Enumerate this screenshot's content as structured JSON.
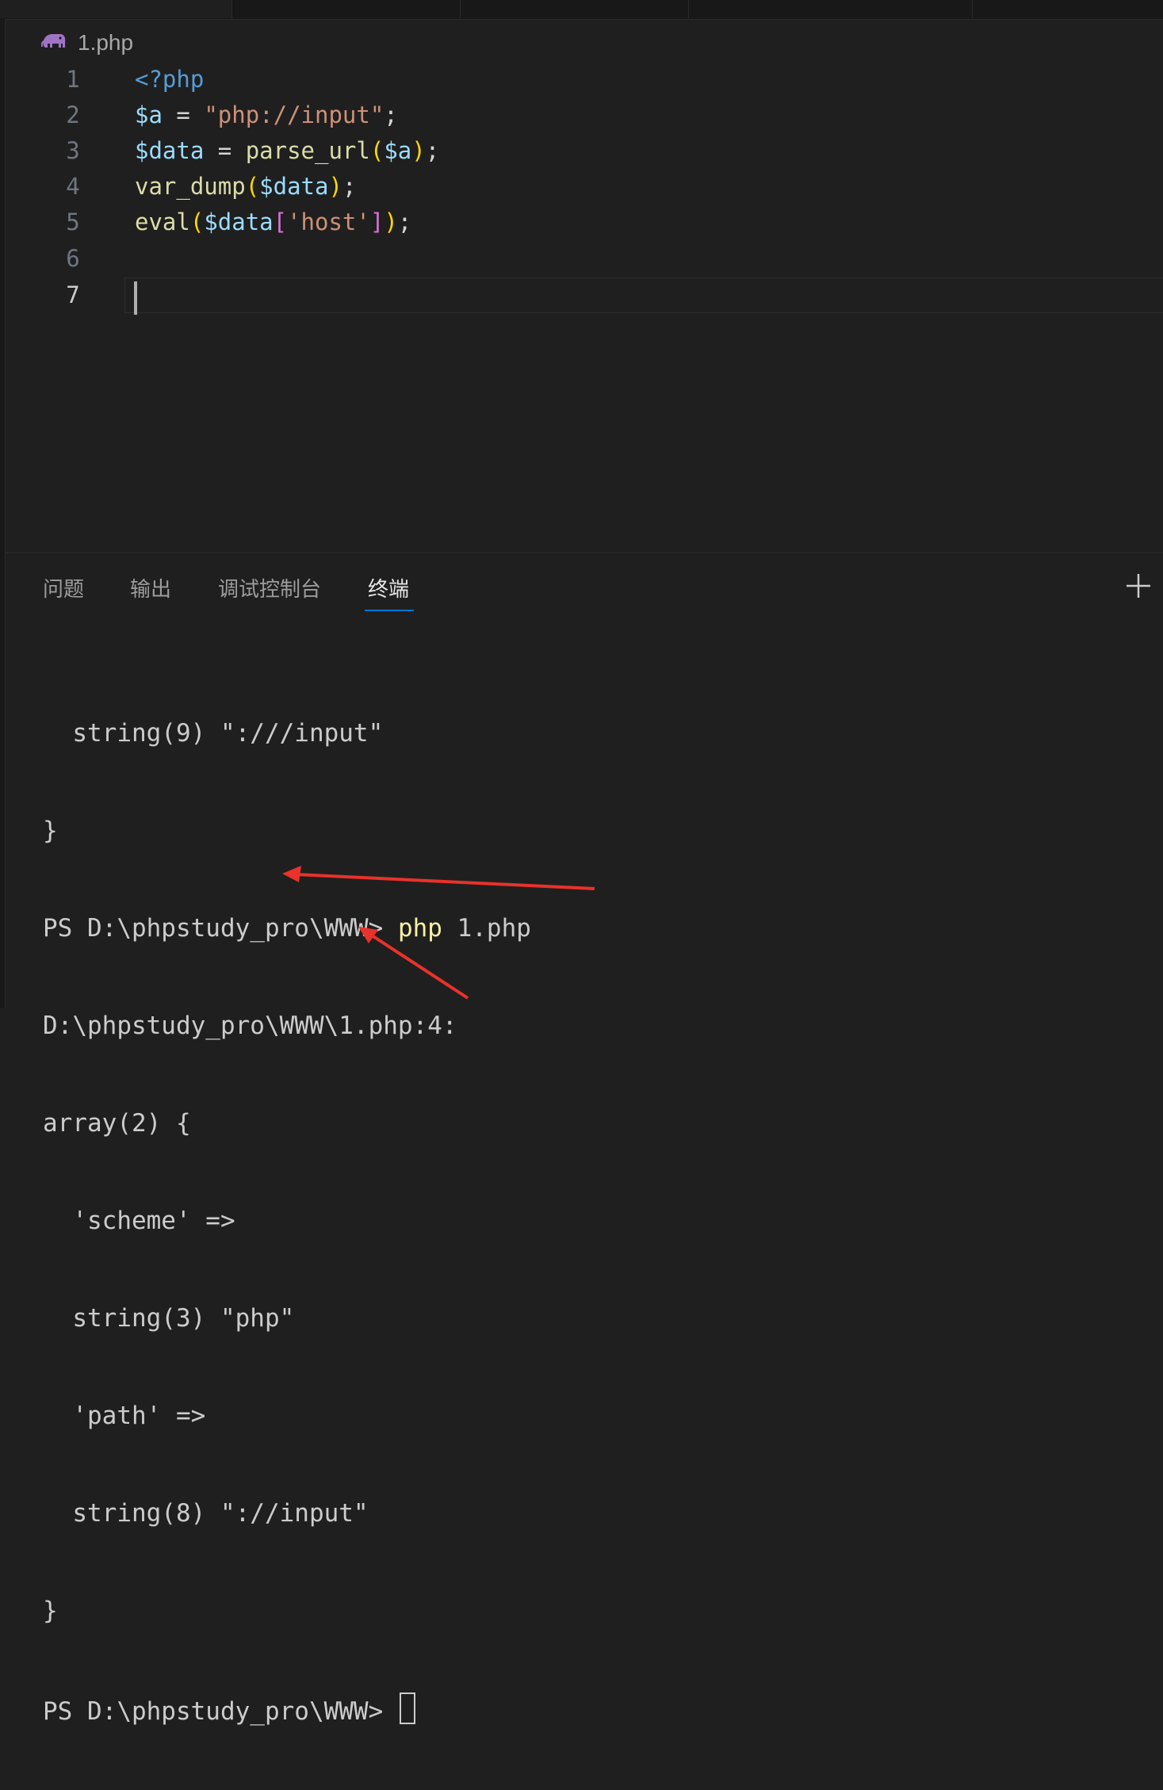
{
  "breadcrumb": {
    "icon": "php-elephant-icon",
    "file": "1.php"
  },
  "editor": {
    "line_numbers": [
      "1",
      "2",
      "3",
      "4",
      "5",
      "6",
      "7"
    ],
    "current_line": "7",
    "code": {
      "l1": [
        "<?php"
      ],
      "l2": [
        "$a",
        " = ",
        "\"php://input\"",
        ";"
      ],
      "l3": [
        "$data",
        " = ",
        "parse_url",
        "(",
        "$a",
        ")",
        ";"
      ],
      "l4": [
        "var_dump",
        "(",
        "$data",
        ")",
        ";"
      ],
      "l5": [
        "eval",
        "(",
        "$data",
        "[",
        "'host'",
        "]",
        ")",
        ";"
      ]
    }
  },
  "panel": {
    "tabs": [
      "问题",
      "输出",
      "调试控制台",
      "终端"
    ],
    "active_tab": "终端",
    "add_icon": "plus-icon"
  },
  "terminal": {
    "lines": [
      "  string(9) \":///input\"",
      "}",
      "PS D:\\phpstudy_pro\\WWW> ",
      "D:\\phpstudy_pro\\WWW\\1.php:4:",
      "array(2) {",
      "  'scheme' =>",
      "  string(3) \"php\"",
      "  'path' =>",
      "  string(8) \"://input\"",
      "}",
      "PS D:\\phpstudy_pro\\WWW> "
    ],
    "command": "php",
    "command_arg": " 1.php"
  },
  "colors": {
    "background": "#1f1f1f",
    "accent": "#0078d4",
    "annotation_arrow": "#e8322b",
    "keyword": "#569cd6",
    "variable": "#9cdcfe",
    "string": "#ce9178",
    "function": "#dcdcaa"
  }
}
